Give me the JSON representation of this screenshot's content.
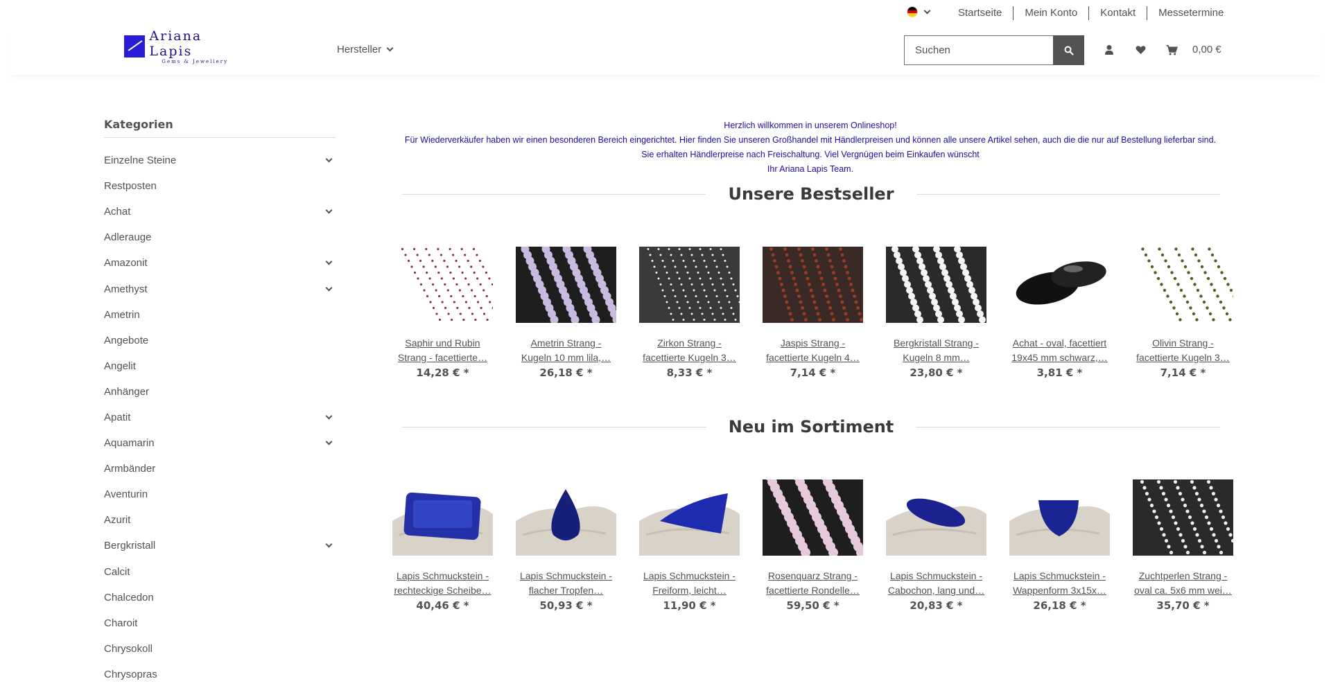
{
  "colors": {
    "text": "#525252",
    "welcome_text": "#1a0fa0",
    "logo": "#2a1bd8",
    "search_button": "#525252"
  },
  "topbar": {
    "language_flag": "germany-flag",
    "links": [
      "Startseite",
      "Mein Konto",
      "Kontakt",
      "Messetermine"
    ]
  },
  "header": {
    "logo_title": "Ariana Lapis",
    "logo_subtitle": "Gems & Jewellery",
    "nav_hersteller": "Hersteller",
    "search_placeholder": "Suchen",
    "cart_total": "0,00 €",
    "icons": [
      "search-icon",
      "user-icon",
      "heart-icon",
      "cart-icon"
    ]
  },
  "sidebar": {
    "title": "Kategorien",
    "items": [
      {
        "label": "Einzelne Steine",
        "expandable": true
      },
      {
        "label": "Restposten",
        "expandable": false
      },
      {
        "label": "Achat",
        "expandable": true
      },
      {
        "label": "Adlerauge",
        "expandable": false
      },
      {
        "label": "Amazonit",
        "expandable": true
      },
      {
        "label": "Amethyst",
        "expandable": true
      },
      {
        "label": "Ametrin",
        "expandable": false
      },
      {
        "label": "Angebote",
        "expandable": false
      },
      {
        "label": "Angelit",
        "expandable": false
      },
      {
        "label": "Anhänger",
        "expandable": false
      },
      {
        "label": "Apatit",
        "expandable": true
      },
      {
        "label": "Aquamarin",
        "expandable": true
      },
      {
        "label": "Armbänder",
        "expandable": false
      },
      {
        "label": "Aventurin",
        "expandable": false
      },
      {
        "label": "Azurit",
        "expandable": false
      },
      {
        "label": "Bergkristall",
        "expandable": true
      },
      {
        "label": "Calcit",
        "expandable": false
      },
      {
        "label": "Chalcedon",
        "expandable": false
      },
      {
        "label": "Charoit",
        "expandable": false
      },
      {
        "label": "Chrysokoll",
        "expandable": false
      },
      {
        "label": "Chrysopras",
        "expandable": false
      }
    ]
  },
  "welcome": {
    "line1": "Herzlich willkommen in unserem Onlineshop!",
    "line2": "Für Wiederverkäufer haben wir einen besonderen Bereich eingerichtet. Hier finden Sie unseren Großhandel mit Händlerpreisen und können alle unsere Artikel sehen, auch die die nur auf Bestellung lieferbar sind.",
    "line3": "Sie erhalten Händlerpreise nach Freischaltung. Viel Vergnügen beim Einkaufen wünscht",
    "line4": "Ihr Ariana Lapis Team."
  },
  "bestseller": {
    "title": "Unsere Bestseller",
    "products": [
      {
        "name1": "Saphir und Rubin",
        "name2": "Strang - facettierte…",
        "price": "14,28 € *"
      },
      {
        "name1": "Ametrin Strang -",
        "name2": "Kugeln 10 mm lila,…",
        "price": "26,18 € *"
      },
      {
        "name1": "Zirkon Strang -",
        "name2": "facettierte Kugeln 3…",
        "price": "8,33 € *"
      },
      {
        "name1": "Jaspis Strang -",
        "name2": "facettierte Kugeln 4…",
        "price": "7,14 € *"
      },
      {
        "name1": "Bergkristall Strang -",
        "name2": "Kugeln 8 mm…",
        "price": "23,80 € *"
      },
      {
        "name1": "Achat - oval, facettiert",
        "name2": "19x45 mm schwarz,…",
        "price": "3,81 € *"
      },
      {
        "name1": "Olivin Strang -",
        "name2": "facettierte Kugeln 3…",
        "price": "7,14 € *"
      }
    ]
  },
  "neu": {
    "title": "Neu im Sortiment",
    "products": [
      {
        "name1": "Lapis Schmuckstein -",
        "name2": "rechteckige Scheibe…",
        "price": "40,46 € *"
      },
      {
        "name1": "Lapis Schmuckstein -",
        "name2": "flacher Tropfen…",
        "price": "50,93 € *"
      },
      {
        "name1": "Lapis Schmuckstein -",
        "name2": "Freiform, leicht…",
        "price": "11,90 € *"
      },
      {
        "name1": "Rosenquarz Strang -",
        "name2": "facettierte Rondelle…",
        "price": "59,50 € *"
      },
      {
        "name1": "Lapis Schmuckstein -",
        "name2": "Cabochon, lang und…",
        "price": "20,83 € *"
      },
      {
        "name1": "Lapis Schmuckstein -",
        "name2": "Wappenform 3x15x…",
        "price": "26,18 € *"
      },
      {
        "name1": "Zuchtperlen Strang -",
        "name2": "oval ca. 5x6 mm wei…",
        "price": "35,70 € *"
      }
    ]
  }
}
